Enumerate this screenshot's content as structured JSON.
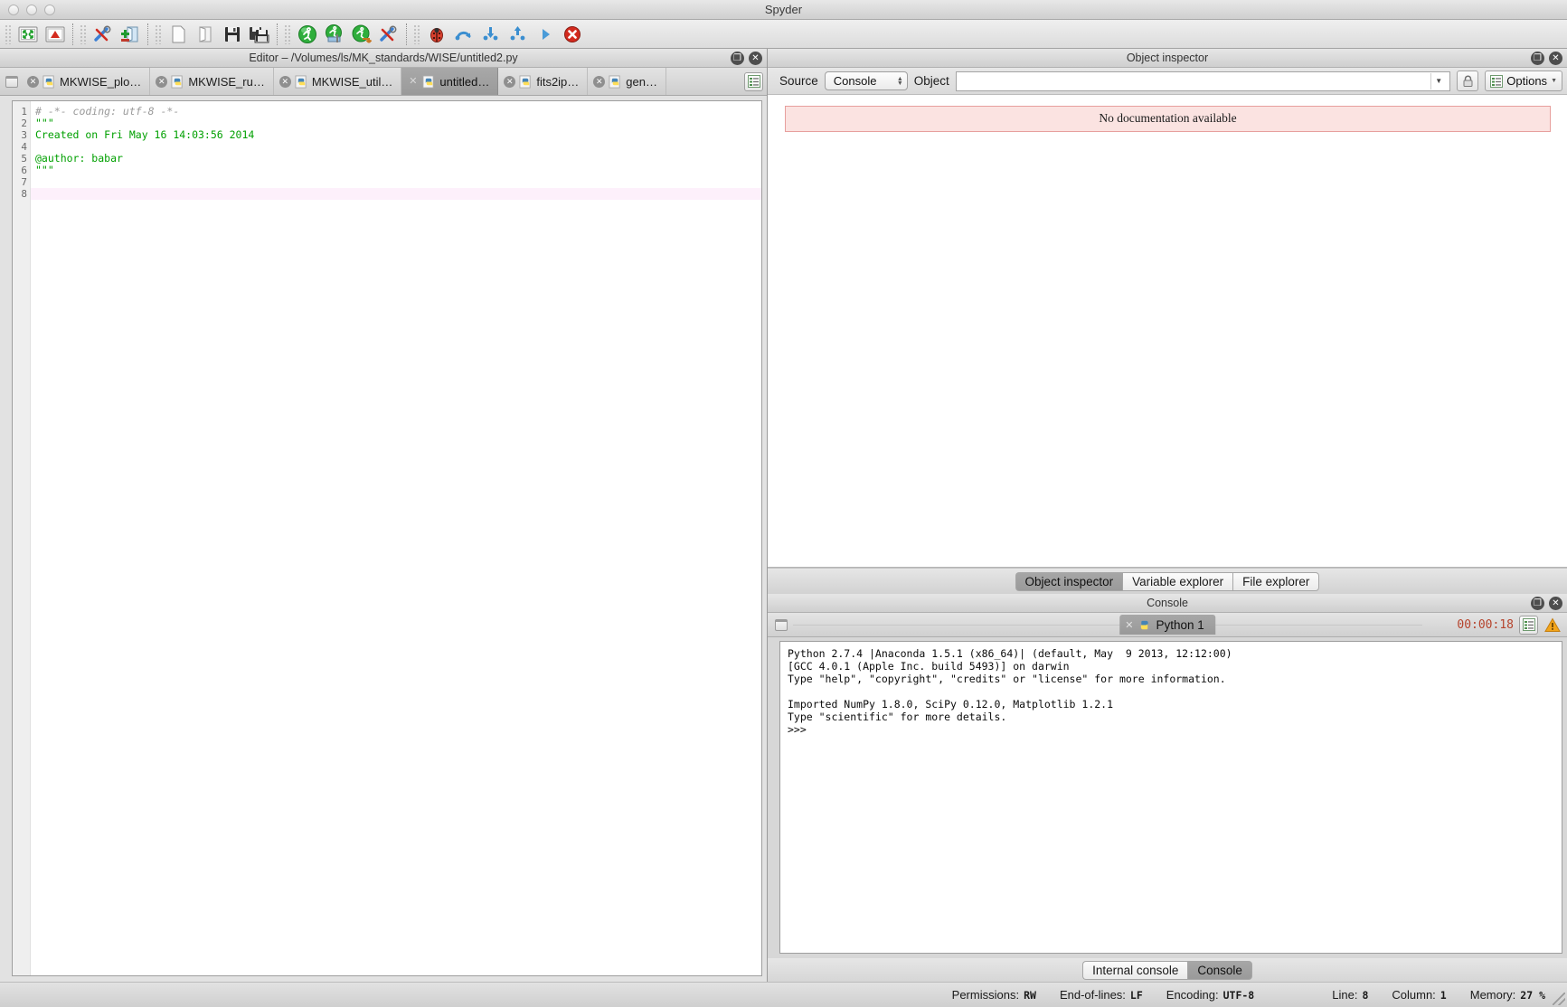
{
  "window": {
    "title": "Spyder",
    "traffic_lights": [
      "close",
      "minimize",
      "zoom"
    ]
  },
  "toolbar": {
    "groups": [
      {
        "items": [
          {
            "name": "maximize-current-pane-icon",
            "label": "Maximize current pane"
          },
          {
            "name": "fullscreen-mode-icon",
            "label": "Fullscreen mode"
          }
        ]
      },
      {
        "items": [
          {
            "name": "preferences-icon",
            "label": "Preferences"
          },
          {
            "name": "pythonpath-manager-icon",
            "label": "PYTHONPATH manager"
          }
        ]
      },
      {
        "items": [
          {
            "name": "new-file-icon",
            "label": "New file"
          },
          {
            "name": "open-file-icon",
            "label": "Open file"
          },
          {
            "name": "save-file-icon",
            "label": "Save file"
          },
          {
            "name": "save-all-icon",
            "label": "Save all"
          }
        ]
      },
      {
        "items": [
          {
            "name": "run-file-icon",
            "label": "Run file"
          },
          {
            "name": "run-settings-icon",
            "label": "Configure current file"
          },
          {
            "name": "run-selection-icon",
            "label": "Run selection or current block"
          },
          {
            "name": "run-settings-alt-icon",
            "label": "Run settings"
          }
        ]
      },
      {
        "items": [
          {
            "name": "debug-file-icon",
            "label": "Debug file"
          },
          {
            "name": "debug-step-over-icon",
            "label": "Step over"
          },
          {
            "name": "debug-step-into-icon",
            "label": "Step into"
          },
          {
            "name": "debug-step-return-icon",
            "label": "Step return"
          },
          {
            "name": "debug-continue-icon",
            "label": "Continue"
          },
          {
            "name": "debug-stop-icon",
            "label": "Stop debugging"
          }
        ]
      }
    ]
  },
  "editor": {
    "pane_title": "Editor – /Volumes/ls/MK_standards/WISE/untitled2.py",
    "tabs": [
      {
        "label": "MKWISE_plo…",
        "active": false
      },
      {
        "label": "MKWISE_ru…",
        "active": false
      },
      {
        "label": "MKWISE_util…",
        "active": false
      },
      {
        "label": "untitled…",
        "active": true
      },
      {
        "label": "fits2ip…",
        "active": false
      },
      {
        "label": "gen…",
        "active": false
      }
    ],
    "browse_tabs_label": "Browse tabs",
    "line_numbers": [
      "1",
      "2",
      "3",
      "4",
      "5",
      "6",
      "7",
      "8"
    ],
    "lines": [
      {
        "text": "# -*- coding: utf-8 -*-",
        "style": "comment"
      },
      {
        "text": "\"\"\"",
        "style": "string"
      },
      {
        "text": "Created on Fri May 16 14:03:56 2014",
        "style": "string"
      },
      {
        "text": "",
        "style": "string"
      },
      {
        "text": "@author: babar",
        "style": "string"
      },
      {
        "text": "\"\"\"",
        "style": "string"
      },
      {
        "text": "",
        "style": "plain"
      },
      {
        "text": "",
        "style": "current"
      }
    ]
  },
  "object_inspector": {
    "pane_title": "Object inspector",
    "source_label": "Source",
    "source_value": "Console",
    "object_label": "Object",
    "object_value": "",
    "object_placeholder": "",
    "lock_button_label": "Lock",
    "options_label": "Options",
    "message": "No documentation available",
    "tabs": [
      {
        "label": "Object inspector",
        "active": true
      },
      {
        "label": "Variable explorer",
        "active": false
      },
      {
        "label": "File explorer",
        "active": false
      }
    ]
  },
  "console": {
    "pane_title": "Console",
    "tab_label": "Python 1",
    "timer": "00:00:18",
    "options_label": "Options",
    "warning_label": "Warning",
    "lines": [
      "Python 2.7.4 |Anaconda 1.5.1 (x86_64)| (default, May  9 2013, 12:12:00)",
      "[GCC 4.0.1 (Apple Inc. build 5493)] on darwin",
      "Type \"help\", \"copyright\", \"credits\" or \"license\" for more information.",
      "",
      "Imported NumPy 1.8.0, SciPy 0.12.0, Matplotlib 1.2.1",
      "Type \"scientific\" for more details.",
      ">>>"
    ],
    "tabs": [
      {
        "label": "Internal console",
        "active": false
      },
      {
        "label": "Console",
        "active": true
      }
    ]
  },
  "status_bar": {
    "items": [
      {
        "label": "Permissions:",
        "value": "RW"
      },
      {
        "label": "End-of-lines:",
        "value": "LF"
      },
      {
        "label": "Encoding:",
        "value": "UTF-8"
      },
      {
        "label": "Line:",
        "value": "8"
      },
      {
        "label": "Column:",
        "value": "1"
      },
      {
        "label": "Memory:",
        "value": "27 %"
      }
    ]
  },
  "colors": {
    "timer": "#b5432c",
    "string_green": "#00a000",
    "comment_gray": "#9a9a9a",
    "error_box_bg": "#fbe3e1",
    "error_box_border": "#e79f9d",
    "current_line": "#fdf0fb"
  }
}
